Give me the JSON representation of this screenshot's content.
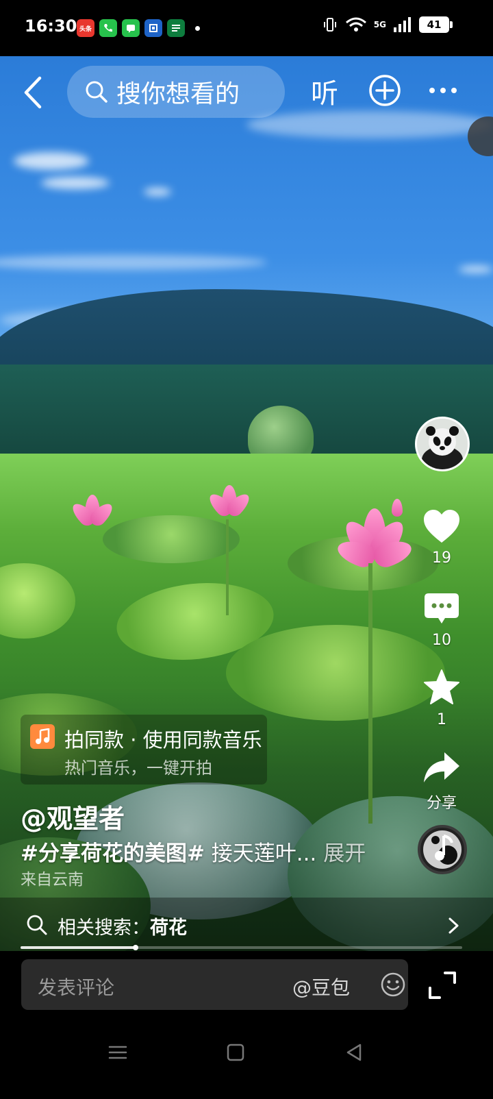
{
  "status_bar": {
    "time": "16:30",
    "network": "5G",
    "battery": "41",
    "app_icons": [
      {
        "name": "toutiao-icon",
        "label": "头条",
        "color": "#e8372e"
      },
      {
        "name": "phone-icon",
        "label": "",
        "color": "#27c24c"
      },
      {
        "name": "messages-icon",
        "label": "",
        "color": "#27c24c"
      },
      {
        "name": "bank-icon",
        "label": "",
        "color": "#1e63c7"
      },
      {
        "name": "postal-icon",
        "label": "",
        "color": "#0e7d3e"
      }
    ]
  },
  "top_bar": {
    "search_placeholder": "搜你想看的",
    "listen_label": "听"
  },
  "actions": {
    "like_count": "19",
    "comment_count": "10",
    "favorite_count": "1",
    "share_label": "分享"
  },
  "music": {
    "title": "拍同款 · 使用同款音乐",
    "subtitle": "热门音乐，一键开拍"
  },
  "post": {
    "author": "@观望者",
    "hashtag": "#分享荷花的美图#",
    "caption_text": " 接天莲叶... ",
    "expand_label": "展开",
    "location": "来自云南"
  },
  "related_search": {
    "prefix": "相关搜索：",
    "keyword": "荷花"
  },
  "playback": {
    "progress": 0.26
  },
  "comment_bar": {
    "placeholder": "发表评论",
    "mention": "@豆包"
  },
  "colors": {
    "accent_music": "#ff8a3d",
    "background": "#000000"
  }
}
